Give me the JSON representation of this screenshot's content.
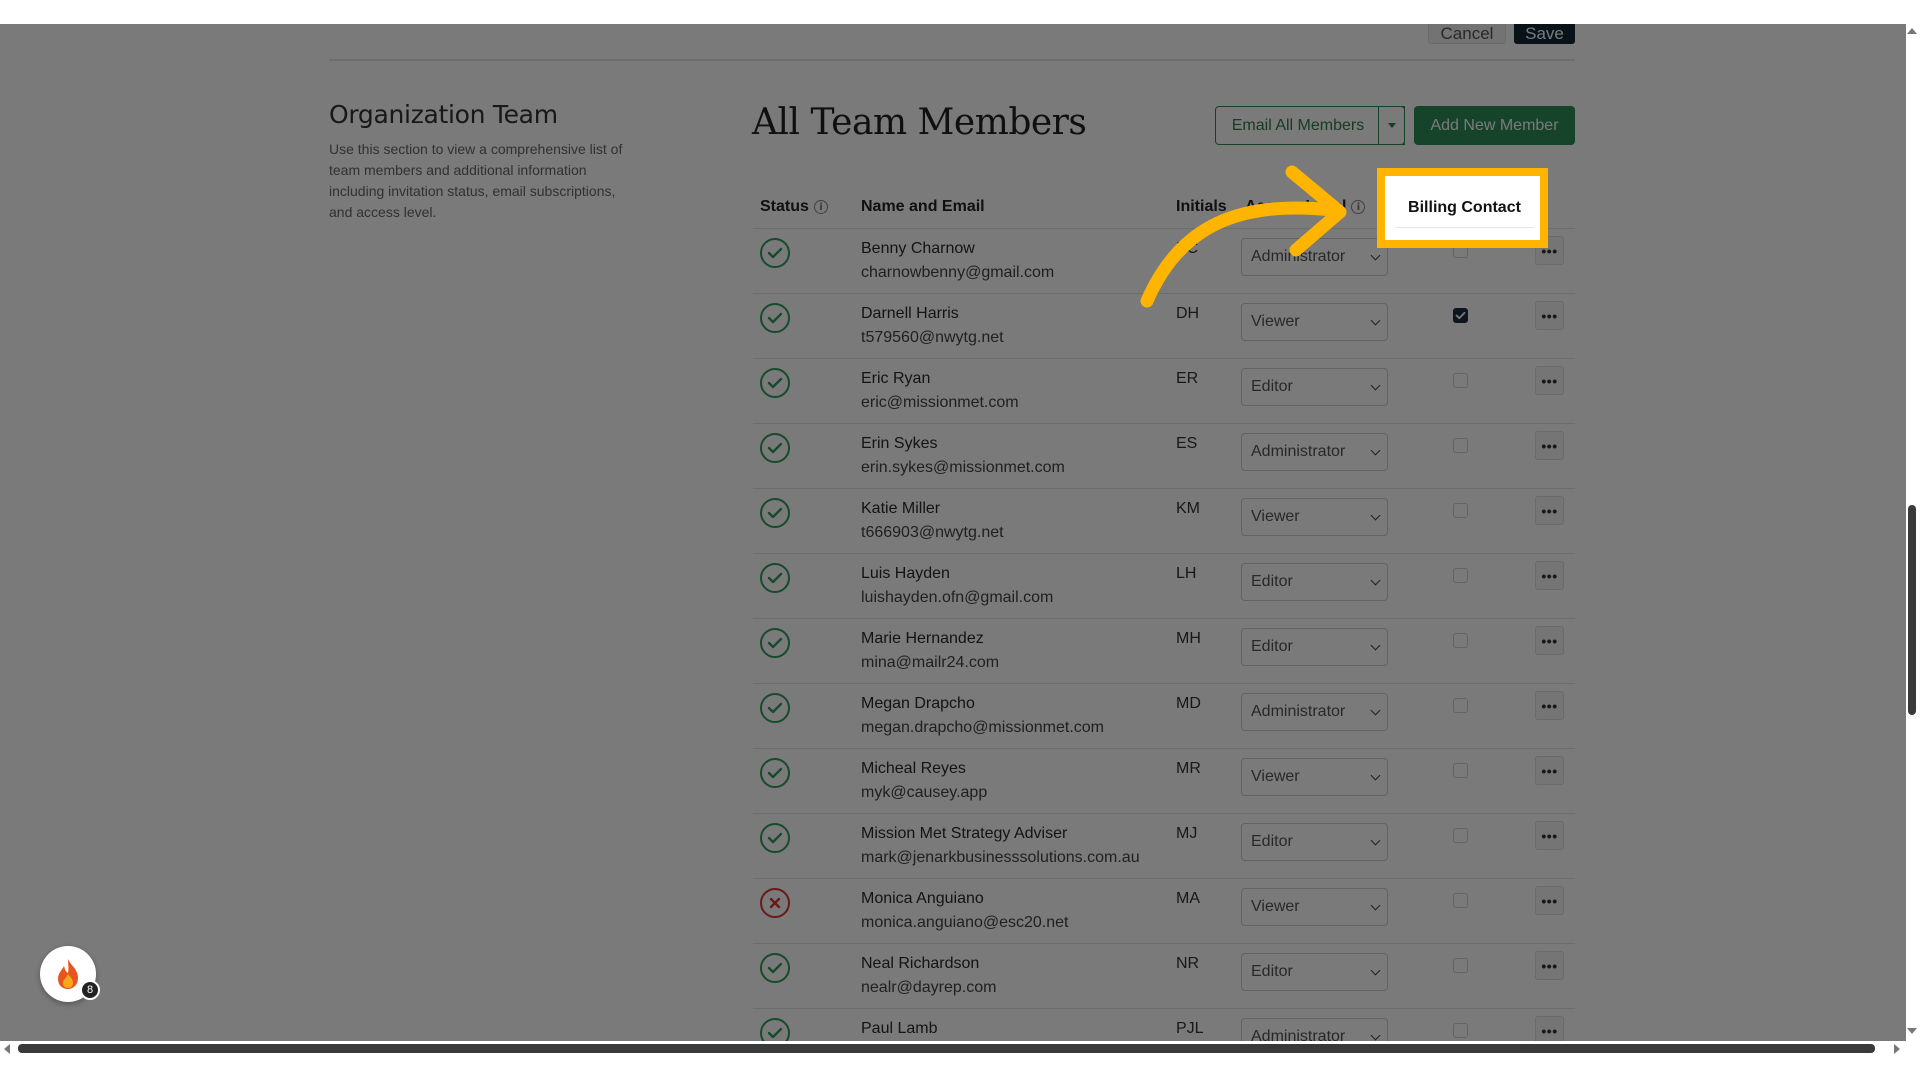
{
  "actions": {
    "cancel": "Cancel",
    "save": "Save"
  },
  "section": {
    "title": "Organization Team",
    "description": "Use this section to view a comprehensive list of team members and additional information including invitation status, email subscriptions, and access level."
  },
  "main": {
    "title": "All Team Members",
    "email_all": "Email All Members",
    "add_member": "Add New Member"
  },
  "table": {
    "headers": {
      "status": "Status",
      "name_email": "Name and Email",
      "initials": "Initials",
      "access": "Access Level",
      "billing": "Billing Contact"
    },
    "rows": [
      {
        "name": "Benny Charnow",
        "email": "charnowbenny@gmail.com",
        "initials": "BC",
        "access": "Administrator",
        "billing": false,
        "status": "active"
      },
      {
        "name": "Darnell Harris",
        "email": "t579560@nwytg.net",
        "initials": "DH",
        "access": "Viewer",
        "billing": true,
        "status": "active"
      },
      {
        "name": "Eric Ryan",
        "email": "eric@missionmet.com",
        "initials": "ER",
        "access": "Editor",
        "billing": false,
        "status": "active"
      },
      {
        "name": "Erin Sykes",
        "email": "erin.sykes@missionmet.com",
        "initials": "ES",
        "access": "Administrator",
        "billing": false,
        "status": "active"
      },
      {
        "name": "Katie Miller",
        "email": "t666903@nwytg.net",
        "initials": "KM",
        "access": "Viewer",
        "billing": false,
        "status": "active"
      },
      {
        "name": "Luis Hayden",
        "email": "luishayden.ofn@gmail.com",
        "initials": "LH",
        "access": "Editor",
        "billing": false,
        "status": "active"
      },
      {
        "name": "Marie Hernandez",
        "email": "mina@mailr24.com",
        "initials": "MH",
        "access": "Editor",
        "billing": false,
        "status": "active"
      },
      {
        "name": "Megan Drapcho",
        "email": "megan.drapcho@missionmet.com",
        "initials": "MD",
        "access": "Administrator",
        "billing": false,
        "status": "active"
      },
      {
        "name": "Micheal Reyes",
        "email": "myk@causey.app",
        "initials": "MR",
        "access": "Viewer",
        "billing": false,
        "status": "active"
      },
      {
        "name": "Mission Met Strategy Adviser",
        "email": "mark@jenarkbusinesssolutions.com.au",
        "initials": "MJ",
        "access": "Editor",
        "billing": false,
        "status": "active"
      },
      {
        "name": "Monica Anguiano",
        "email": "monica.anguiano@esc20.net",
        "initials": "MA",
        "access": "Viewer",
        "billing": false,
        "status": "error"
      },
      {
        "name": "Neal Richardson",
        "email": "nealr@dayrep.com",
        "initials": "NR",
        "access": "Editor",
        "billing": false,
        "status": "active"
      },
      {
        "name": "Paul Lamb",
        "email": "",
        "initials": "PJL",
        "access": "Administrator",
        "billing": false,
        "status": "active"
      }
    ]
  },
  "widget": {
    "badge_count": "8",
    "icon": "flame-icon"
  },
  "colors": {
    "accent_green": "#2f8f5b",
    "highlight": "#ffb400",
    "error_red": "#d93636",
    "dark_navy": "#0f2636"
  }
}
